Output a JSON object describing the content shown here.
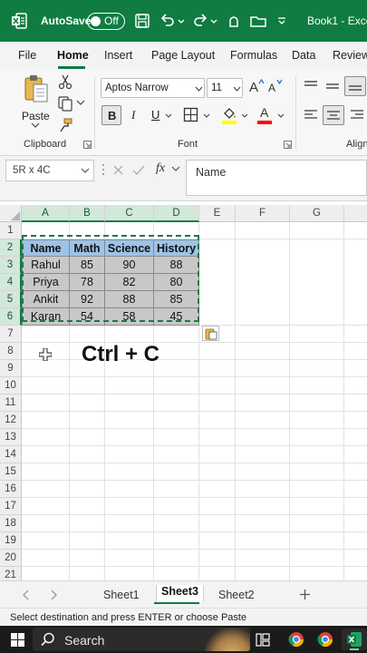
{
  "titlebar": {
    "autosave_label": "AutoSave",
    "autosave_state": "Off",
    "filename": "Book1 - Exce"
  },
  "tabs": [
    {
      "label": "File"
    },
    {
      "label": "Home",
      "active": true
    },
    {
      "label": "Insert"
    },
    {
      "label": "Page Layout"
    },
    {
      "label": "Formulas"
    },
    {
      "label": "Data"
    },
    {
      "label": "Review"
    }
  ],
  "ribbon": {
    "clipboard_label": "Clipboard",
    "paste_label": "Paste",
    "font_label": "Font",
    "alignment_label": "Align",
    "font_name": "Aptos Narrow",
    "font_size": "11",
    "bold": "B",
    "italic": "I",
    "underline": "U",
    "font_grow": "A",
    "font_shrink": "A",
    "font_color_letter": "A"
  },
  "formulabar": {
    "namebox": "5R x 4C",
    "fx": "fx",
    "content": "Name"
  },
  "grid": {
    "columns": [
      "A",
      "B",
      "C",
      "D",
      "E",
      "F",
      "G"
    ],
    "rows": [
      "1",
      "2",
      "3",
      "4",
      "5",
      "6",
      "7",
      "8",
      "9",
      "10",
      "11",
      "12",
      "13",
      "14",
      "15",
      "16",
      "17",
      "18",
      "19",
      "20",
      "21"
    ],
    "table_header": [
      "Name",
      "Math",
      "Science",
      "History"
    ],
    "table_rows": [
      [
        "Rahul",
        "85",
        "90",
        "88"
      ],
      [
        "Priya",
        "78",
        "82",
        "80"
      ],
      [
        "Ankit",
        "92",
        "88",
        "85"
      ],
      [
        "Karan",
        "54",
        "58",
        "45"
      ]
    ],
    "overlay_text": "Ctrl + C"
  },
  "sheets": [
    {
      "label": "Sheet1"
    },
    {
      "label": "Sheet3",
      "active": true
    },
    {
      "label": "Sheet2"
    }
  ],
  "statusbar": {
    "message": "Select destination and press ENTER or choose Paste"
  },
  "taskbar": {
    "search_label": "Search"
  },
  "colors": {
    "excel_green": "#107c41",
    "header_blue": "#9dc3e6",
    "cell_gray": "#c8c8c8"
  }
}
